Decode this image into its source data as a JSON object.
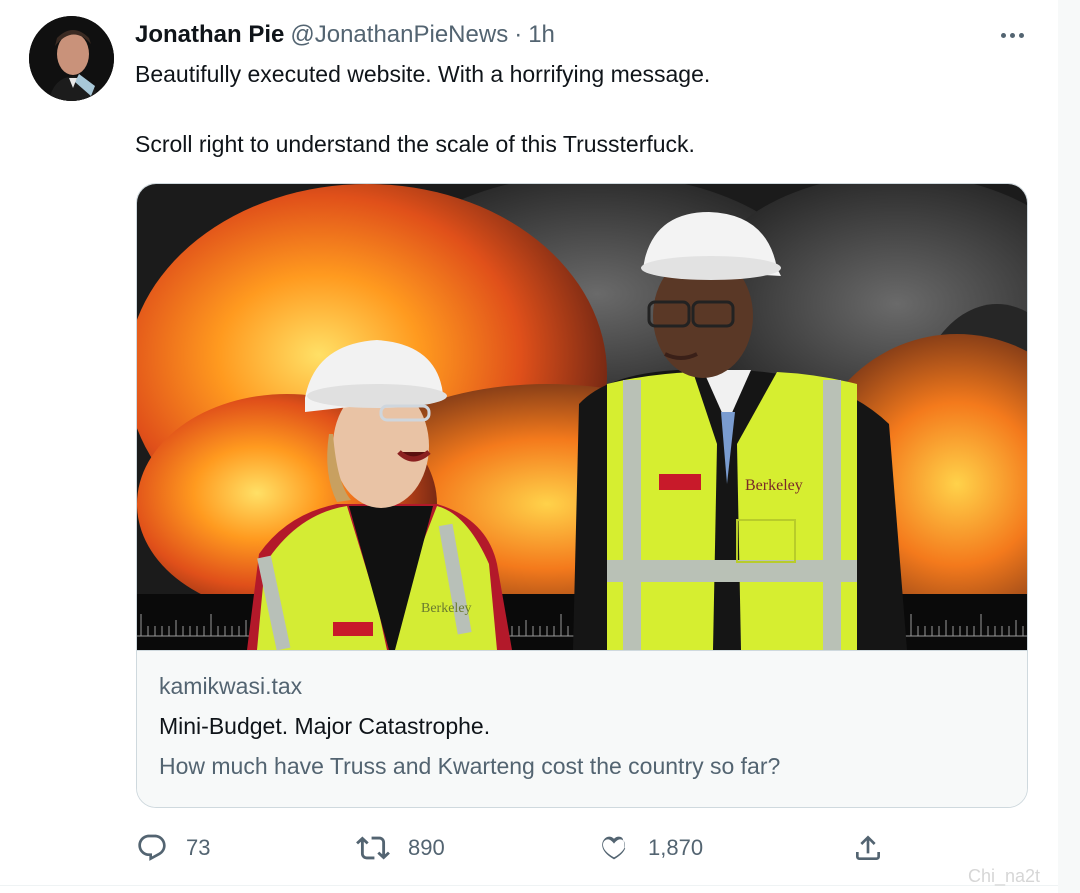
{
  "tweet": {
    "author": {
      "display_name": "Jonathan Pie",
      "handle": "@JonathanPieNews",
      "separator": "·",
      "time": "1h"
    },
    "text_lines": [
      "Beautifully executed website. With a horrifying message.",
      "Scroll right to understand the scale of this Trussterfuck."
    ],
    "card": {
      "domain": "kamikwasi.tax",
      "title": "Mini-Budget. Major Catastrophe.",
      "description": "How much have Truss and Kwarteng cost the country so far?",
      "image_vest_text_left": "Berkeley",
      "image_vest_text_right": "Berkeley"
    },
    "actions": {
      "replies": "73",
      "retweets": "890",
      "likes": "1,870"
    },
    "icons": [
      "more-icon",
      "reply-icon",
      "retweet-icon",
      "like-icon",
      "share-icon"
    ]
  },
  "watermark": "Chi_na2t",
  "colors": {
    "text_primary": "#0f1419",
    "text_secondary": "#536471",
    "card_border": "#cfd9de",
    "vest_yellow": "#d9f03a"
  }
}
